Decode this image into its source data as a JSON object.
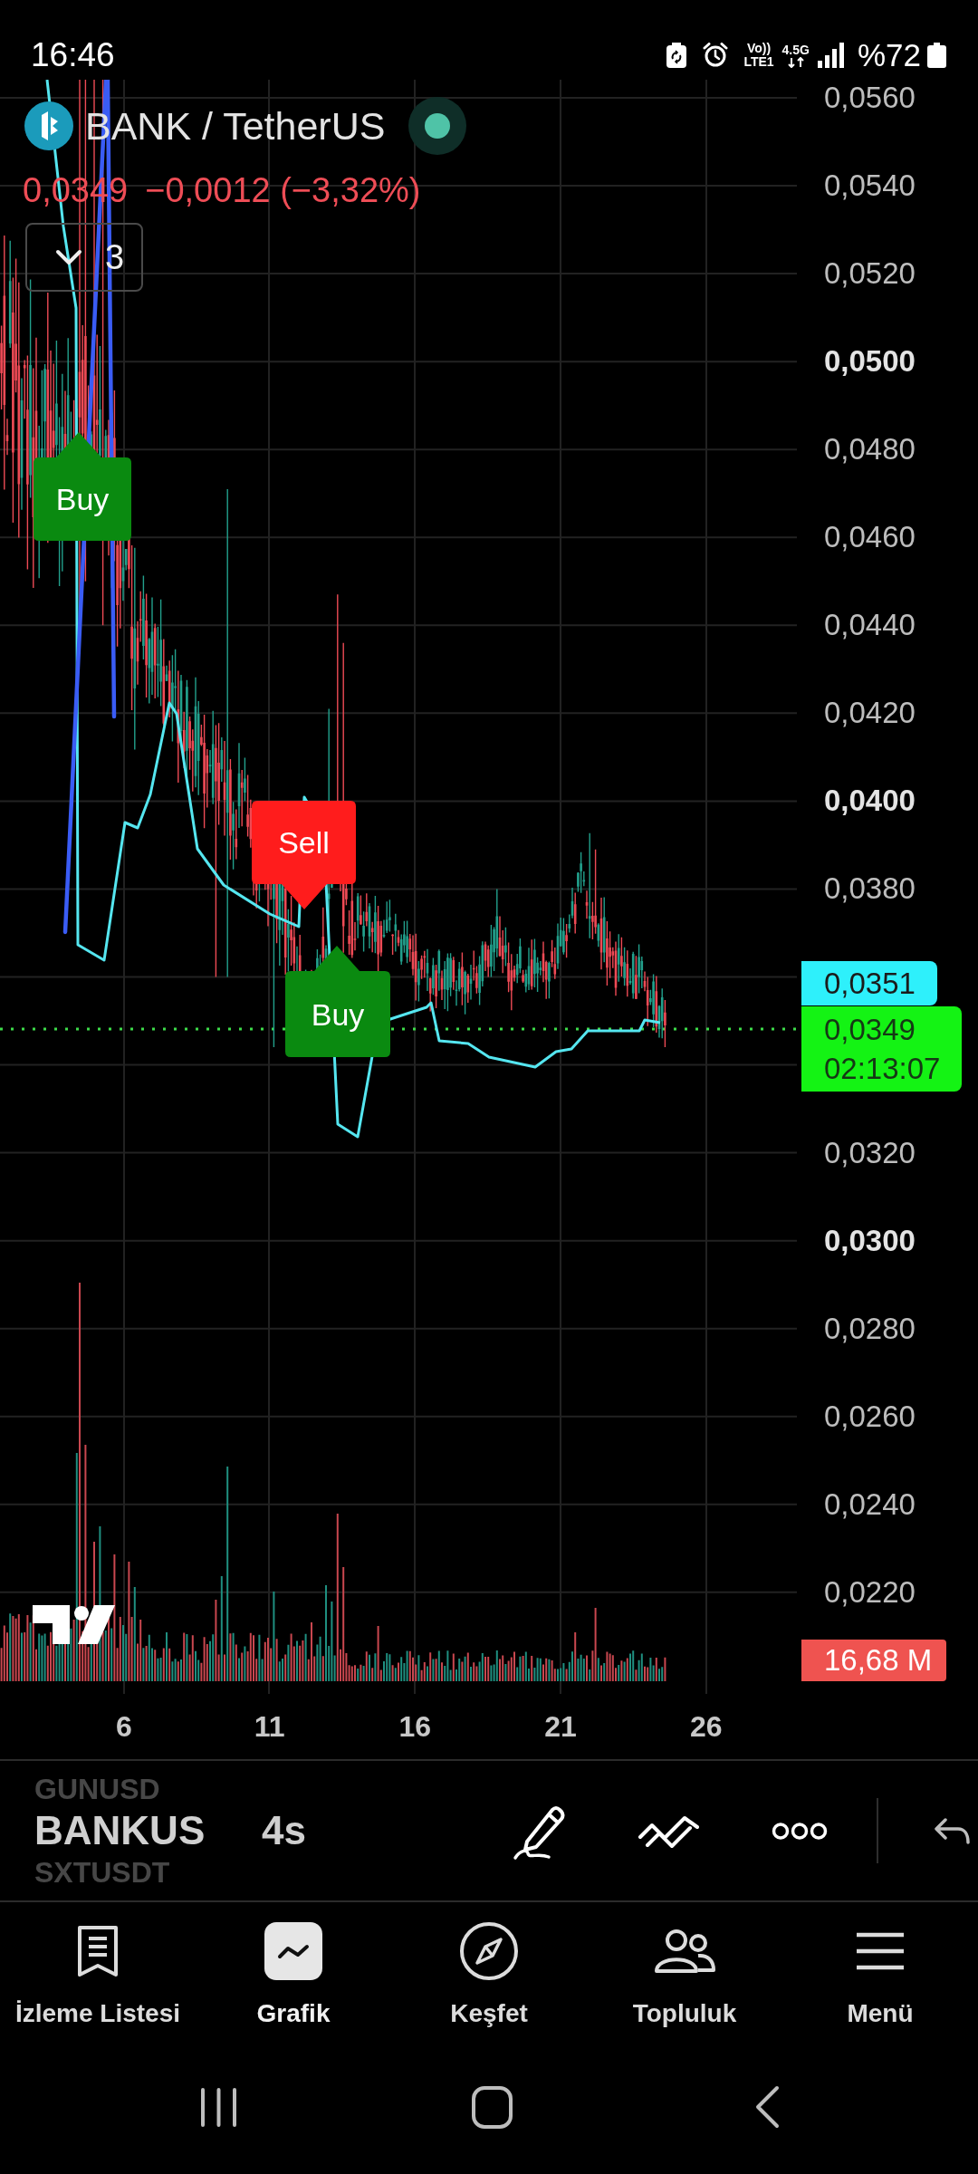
{
  "status_bar": {
    "time": "16:46",
    "volte": "Vo))",
    "lte": "LTE1",
    "network": "4.5G",
    "battery": "%72"
  },
  "symbol": {
    "title": "BANK / TetherUS",
    "market_open": true,
    "price": "0,0349",
    "change": "−0,0012 (−3,32%)",
    "indicators": "3"
  },
  "chart": {
    "signals": [
      {
        "kind": "buy",
        "label": "Buy"
      },
      {
        "kind": "sell",
        "label": "Sell"
      },
      {
        "kind": "buy",
        "label": "Buy"
      }
    ],
    "price_axis_upper": [
      {
        "label": "0,0560",
        "major": false
      },
      {
        "label": "0,0540",
        "major": false
      },
      {
        "label": "0,0520",
        "major": false
      },
      {
        "label": "0,0500",
        "major": true
      },
      {
        "label": "0,0480",
        "major": false
      },
      {
        "label": "0,0460",
        "major": false
      },
      {
        "label": "0,0440",
        "major": false
      },
      {
        "label": "0,0420",
        "major": false
      },
      {
        "label": "0,0400",
        "major": true
      },
      {
        "label": "0,0380",
        "major": false
      }
    ],
    "price_tags": [
      {
        "kind": "indicator",
        "label": "0,0351"
      },
      {
        "kind": "last_price",
        "label": "0,0349",
        "countdown": "02:13:07"
      }
    ],
    "price_axis_lower": [
      {
        "label": "0,0320",
        "major": false
      },
      {
        "label": "0,0300",
        "major": true
      },
      {
        "label": "0,0280",
        "major": false
      },
      {
        "label": "0,0260",
        "major": false
      },
      {
        "label": "0,0240",
        "major": false
      },
      {
        "label": "0,0220",
        "major": false
      }
    ],
    "volume_tag": "16,68 M",
    "time_axis": [
      "6",
      "11",
      "16",
      "21",
      "26"
    ]
  },
  "toolbar": {
    "symbols": [
      {
        "label": "GUNUSD",
        "selected": false
      },
      {
        "label": "BANKUS",
        "selected": true
      },
      {
        "label": "SXTUSDT",
        "selected": false
      }
    ],
    "interval": "4s"
  },
  "nav": [
    {
      "label": "İzleme Listesi",
      "selected": false
    },
    {
      "label": "Grafik",
      "selected": true
    },
    {
      "label": "Keşfet",
      "selected": false
    },
    {
      "label": "Topluluk",
      "selected": false
    },
    {
      "label": "Menü",
      "selected": false
    }
  ]
}
